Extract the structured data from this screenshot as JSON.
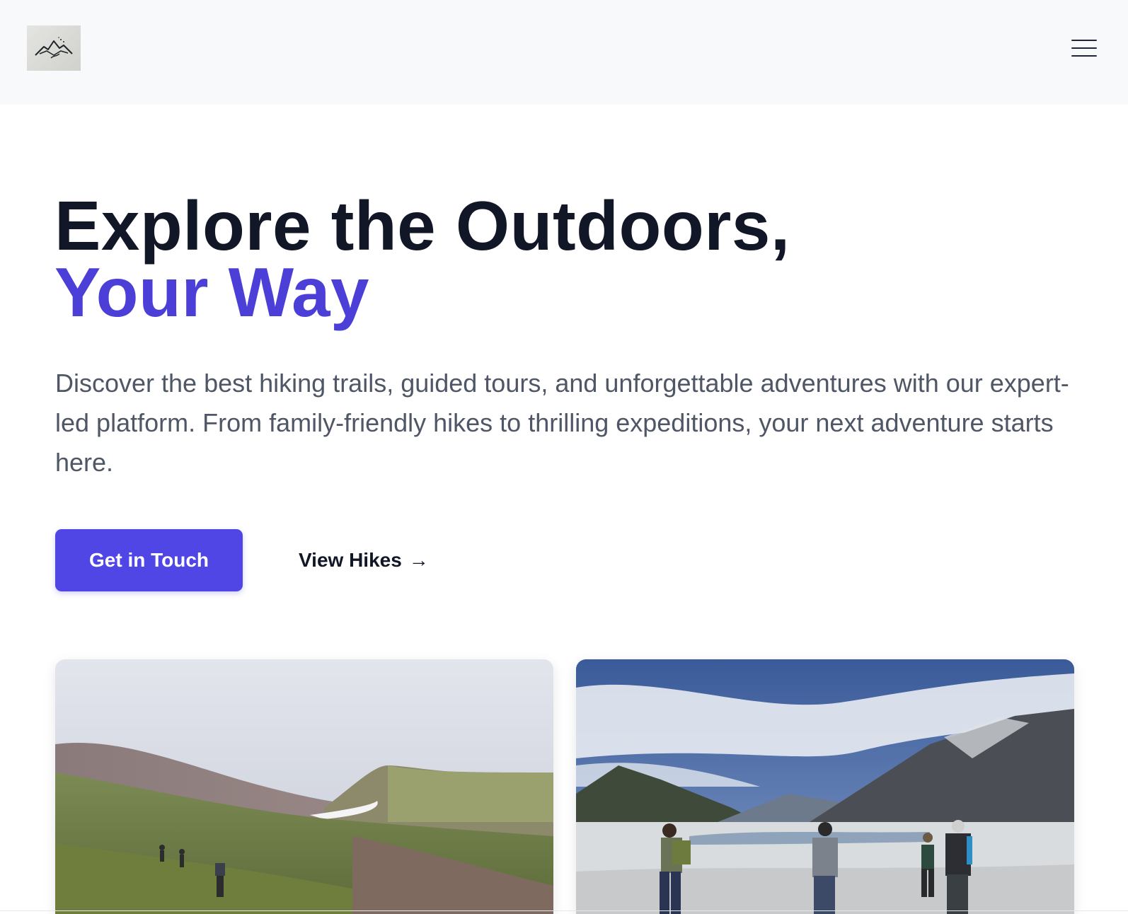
{
  "header": {
    "logo_icon": "mountain-logo-icon",
    "menu_icon": "hamburger-menu-icon"
  },
  "hero": {
    "title_line1": "Explore the Outdoors,",
    "title_line2": "Your Way",
    "description": "Discover the best hiking trails, guided tours, and unforgettable adventures with our expert-led platform. From family-friendly hikes to thrilling expeditions, your next adventure starts here.",
    "primary_button": "Get in Touch",
    "secondary_link": "View Hikes",
    "secondary_arrow": "→"
  },
  "colors": {
    "accent": "#4f46e5",
    "title": "#111726",
    "body_text": "#4f5766",
    "header_bg": "#f8f9fb"
  },
  "gallery": {
    "images": [
      {
        "icon": "hikers-on-green-hillside-image"
      },
      {
        "icon": "hikers-by-snowy-river-mountains-image"
      }
    ]
  }
}
